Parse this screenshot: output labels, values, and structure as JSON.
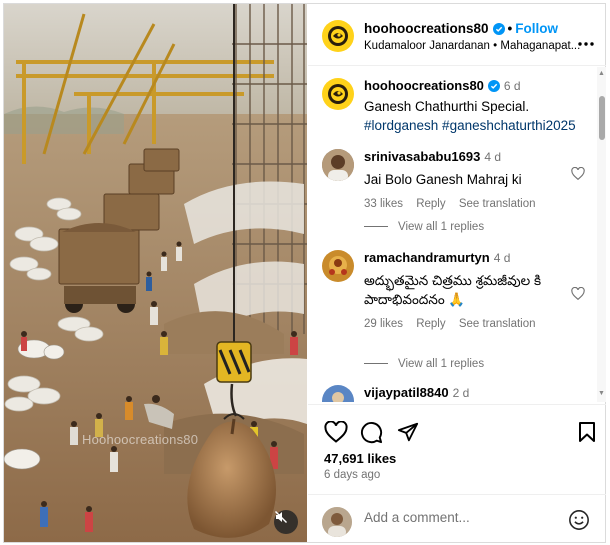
{
  "media": {
    "watermark": "Hoohoocreations80",
    "mute_icon": "speaker-muted-icon"
  },
  "header": {
    "username": "hoohoocreations80",
    "follow_label": "Follow",
    "dot": "•",
    "subtitle": "Kudamaloor Janardanan • Mahaganapat...",
    "more_icon": "more-horizontal-icon"
  },
  "caption": {
    "username": "hoohoocreations80",
    "time": "6 d",
    "text": "Ganesh Chathurthi Special.",
    "tags": "#lordganesh #ganeshchaturthi2025"
  },
  "comments": [
    {
      "username": "srinivasababu1693",
      "time": "4 d",
      "text": "Jai Bolo Ganesh Mahraj ki",
      "likes": "33 likes",
      "reply": "Reply",
      "translate": "See translation",
      "replies": "View all 1 replies"
    },
    {
      "username": "ramachandramurtyn",
      "time": "4 d",
      "text": "అద్భుతమైన చిత్రము శ్రమజీవుల కి పాదాభివందనం 🙏",
      "likes": "29 likes",
      "reply": "Reply",
      "translate": "See translation",
      "replies": "View all 1 replies"
    },
    {
      "username": "vijaypatil8840",
      "time": "2 d"
    }
  ],
  "actions": {
    "likes": "47,691 likes",
    "date": "6 days ago"
  },
  "add_comment": {
    "placeholder": "Add a comment..."
  },
  "colors": {
    "accent": "#0095f6",
    "verified": "#0095f6",
    "secondary_text": "#737373",
    "brand_yellow": "#ffd21a"
  }
}
